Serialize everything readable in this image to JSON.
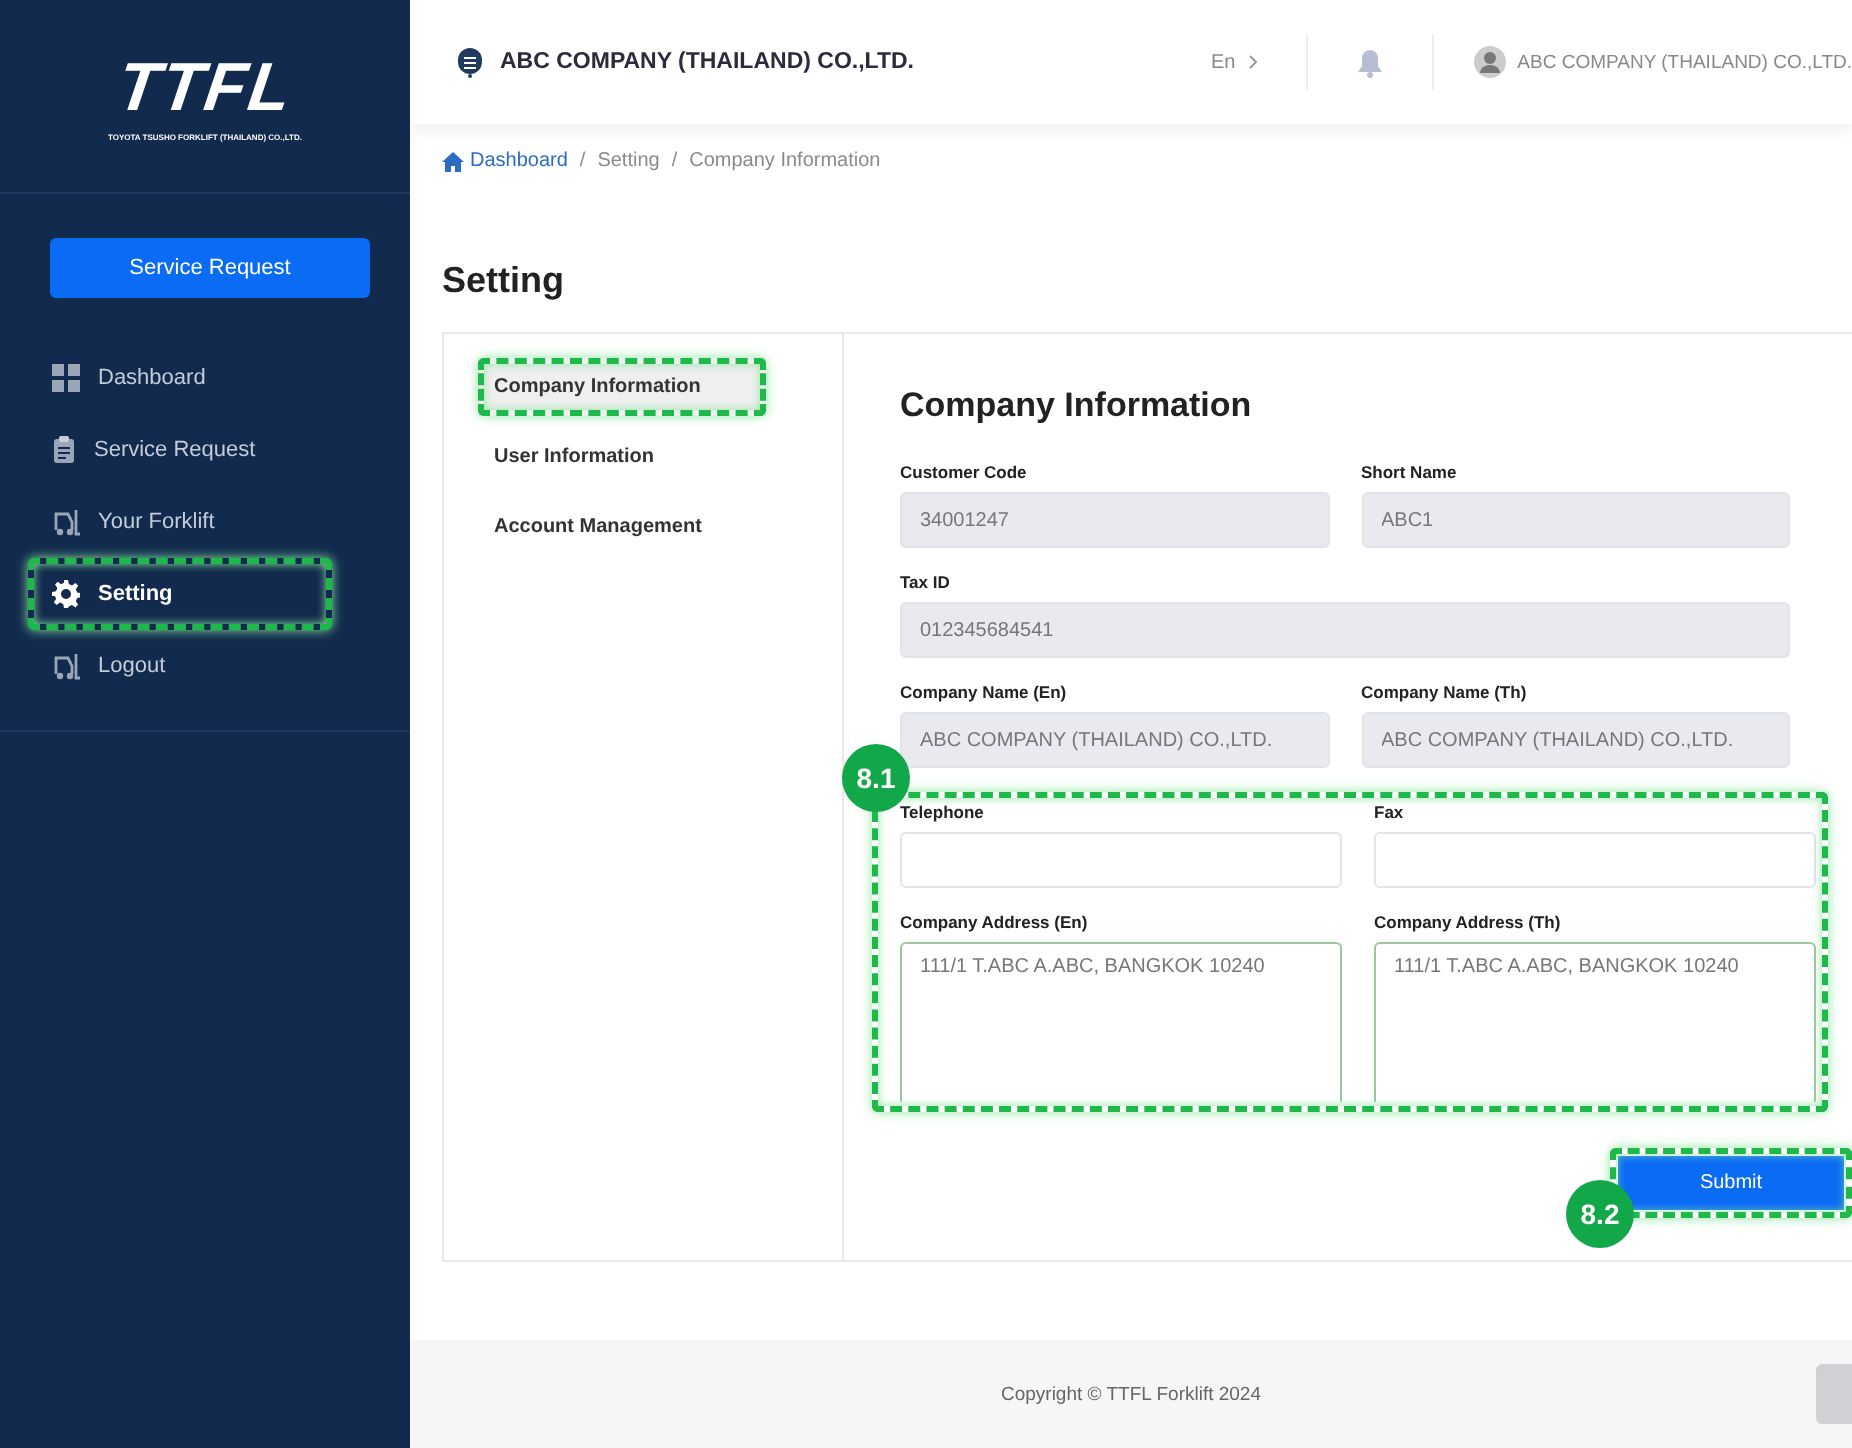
{
  "sidebar": {
    "logo": {
      "mark": "TTFL",
      "tagline": "TOYOTA TSUSHO FORKLIFT (THAILAND) CO.,LTD."
    },
    "primary_button": "Service Request",
    "items": [
      {
        "label": "Dashboard",
        "selected": false,
        "highlighted": false
      },
      {
        "label": "Service Request",
        "selected": false,
        "highlighted": false
      },
      {
        "label": "Your Forklift",
        "selected": false,
        "highlighted": false
      },
      {
        "label": "Setting",
        "selected": true,
        "highlighted": true
      },
      {
        "label": "Logout",
        "selected": false,
        "highlighted": false
      }
    ]
  },
  "header": {
    "company": "ABC COMPANY (THAILAND) CO.,LTD.",
    "language": "En",
    "user": "ABC COMPANY (THAILAND) CO.,LTD."
  },
  "breadcrumb": [
    {
      "label": "Dashboard",
      "kind": "home"
    },
    {
      "label": "/",
      "kind": "separator"
    },
    {
      "label": "Setting",
      "kind": "plain"
    },
    {
      "label": "/",
      "kind": "separator"
    },
    {
      "label": "Company Information",
      "kind": "plain"
    }
  ],
  "page_title": "Setting",
  "tabs": [
    {
      "label": "Company Information",
      "selected": true,
      "highlighted": true
    },
    {
      "label": "User Information",
      "selected": false,
      "highlighted": false
    },
    {
      "label": "Account Management",
      "selected": false,
      "highlighted": false
    }
  ],
  "form": {
    "title": "Company Information",
    "sections": [
      {
        "rows": [
          [
            {
              "label": "Customer Code",
              "value": "34001247",
              "kind": "readonly"
            },
            {
              "label": "Short Name",
              "value": "ABC1",
              "kind": "readonly"
            }
          ],
          [
            {
              "label": "Tax ID",
              "value": "012345684541",
              "kind": "readonly"
            }
          ],
          [
            {
              "label": "Company Name (En)",
              "value": "ABC COMPANY (THAILAND) CO.,LTD.",
              "kind": "readonly"
            },
            {
              "label": "Company Name (Th)",
              "value": "ABC COMPANY (THAILAND) CO.,LTD.",
              "kind": "readonly"
            }
          ]
        ]
      },
      {
        "callout": "8.1",
        "rows": [
          [
            {
              "label": "Telephone",
              "kind": "input"
            },
            {
              "label": "Fax",
              "kind": "input"
            }
          ],
          [
            {
              "label": "Company Address (En)",
              "value": "111/1 T.ABC A.ABC, BANGKOK 10240",
              "kind": "textarea"
            },
            {
              "label": "Company Address (Th)",
              "value": "111/1 T.ABC A.ABC, BANGKOK 10240",
              "kind": "textarea"
            }
          ]
        ]
      }
    ],
    "submit": {
      "label": "Submit",
      "callout": "8.2"
    }
  },
  "footer": "Copyright © TTFL Forklift 2024"
}
